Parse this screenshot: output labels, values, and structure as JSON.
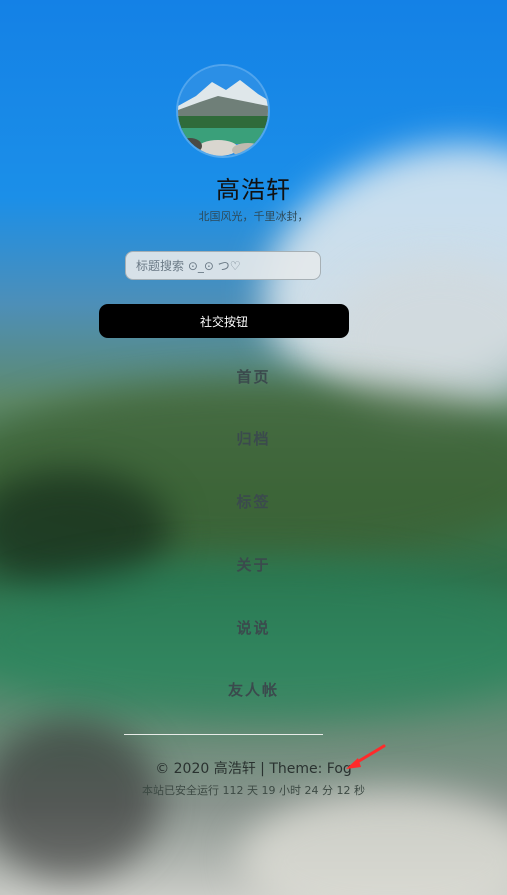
{
  "site": {
    "title": "高浩轩",
    "subtitle": "北国风光，千里冰封，"
  },
  "search": {
    "placeholder": "标题搜索 ⊙_⊙ つ♡"
  },
  "social_button_label": "社交按钮",
  "nav": {
    "items": [
      {
        "label": "首页"
      },
      {
        "label": "归档"
      },
      {
        "label": "标签"
      },
      {
        "label": "关于"
      },
      {
        "label": "说说"
      },
      {
        "label": "友人帐"
      }
    ]
  },
  "footer": {
    "copyright": "© 2020 高浩轩 | Theme: Fog",
    "runtime": "本站已安全运行 112 天 19 小时 24 分 12 秒"
  },
  "colors": {
    "annotation_arrow": "#ff2a2a",
    "button_bg": "#000000"
  }
}
